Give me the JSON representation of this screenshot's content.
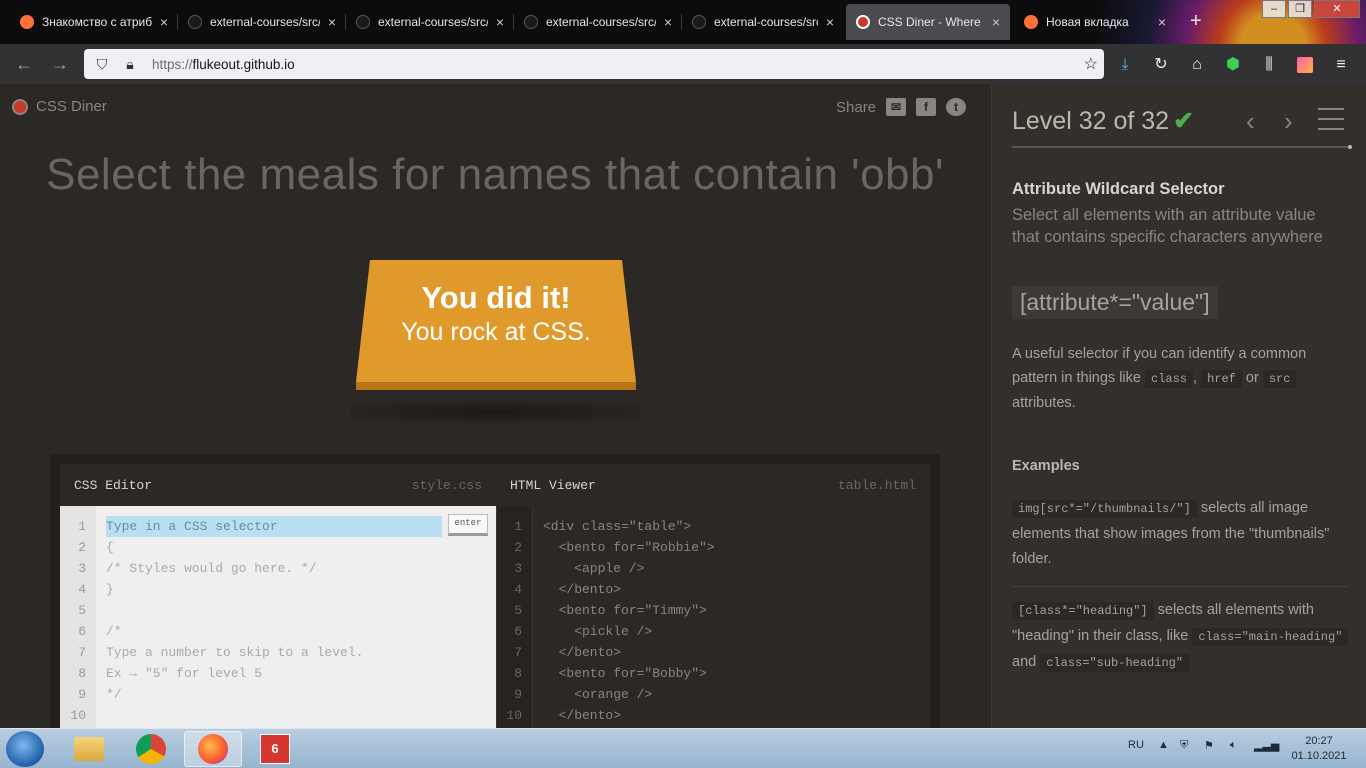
{
  "browser": {
    "tabs": [
      {
        "title": "Знакомство с атрибу",
        "favicon_color": "#ff7139"
      },
      {
        "title": "external-courses/src/",
        "favicon_color": "#1b1b1f"
      },
      {
        "title": "external-courses/src/",
        "favicon_color": "#1b1b1f"
      },
      {
        "title": "external-courses/src/",
        "favicon_color": "#1b1b1f"
      },
      {
        "title": "external-courses/src/",
        "favicon_color": "#1b1b1f"
      },
      {
        "title": "CSS Diner - Where we",
        "favicon_color": "#c8392b"
      },
      {
        "title": "Новая вкладка",
        "favicon_color": "#ff7139"
      }
    ],
    "tab_close": "×",
    "new_tab": "+",
    "window_controls": {
      "minimize": "–",
      "restore": "❐",
      "close": "✕"
    },
    "url": {
      "prefix": "https://",
      "host": "flukeout.github.io"
    },
    "icons": [
      "back-icon",
      "forward-icon",
      "shield-icon",
      "lock-icon",
      "star-icon",
      "download-icon",
      "reload-icon",
      "home-icon",
      "extension-icon",
      "library-icon",
      "profile-icon",
      "menu-icon"
    ]
  },
  "site": {
    "logo": "CSS Diner",
    "share_label": "Share",
    "headline": "Select the meals for names that contain 'obb'",
    "success": {
      "line1": "You did it!",
      "line2": "You rock at CSS."
    },
    "table_color": "#e09a2b"
  },
  "editor": {
    "css_title": "CSS Editor",
    "css_file": "style.css",
    "enter_label": "enter",
    "css_placeholder": "Type in a CSS selector",
    "css_lines": [
      "{",
      "/* Styles would go here. */",
      "}",
      "",
      "/*",
      "Type a number to skip to a level.",
      "Ex → \"5\" for level 5",
      "*/",
      ""
    ],
    "line_numbers": [
      "1",
      "2",
      "3",
      "4",
      "5",
      "6",
      "7",
      "8",
      "9",
      "10"
    ],
    "html_title": "HTML Viewer",
    "html_file": "table.html",
    "html_lines": [
      "<div class=\"table\">",
      "  <bento for=\"Robbie\">",
      "    <apple />",
      "  </bento>",
      "  <bento for=\"Timmy\">",
      "    <pickle />",
      "  </bento>",
      "  <bento for=\"Bobby\">",
      "    <orange />",
      "  </bento>"
    ]
  },
  "sidebar": {
    "level_text": "Level 32 of 32",
    "check": "✔",
    "prev": "‹",
    "next": "›",
    "title": "Attribute Wildcard Selector",
    "description": "Select all elements with an attribute value that contains specific characters anywhere",
    "syntax": "[attribute*=\"value\"]",
    "help_pre": "A useful selector if you can identify a common pattern in things like",
    "help_chip1": "class",
    "help_comma": ",",
    "help_chip2": "href",
    "help_or": "or",
    "help_chip3": "src",
    "help_post": "attributes.",
    "examples_title": "Examples",
    "ex1_code": "img[src*=\"/thumbnails/\"]",
    "ex1_text": "selects all image elements that show images from the \"thumbnails\" folder.",
    "ex2_code": "[class*=\"heading\"]",
    "ex2_text": "selects all elements with \"heading\" in their class, like",
    "ex2_chip1": "class=\"main-heading\"",
    "ex2_and": "and",
    "ex2_chip2": "class=\"sub-heading\""
  },
  "taskbar": {
    "apps": [
      "explorer",
      "chrome",
      "firefox",
      "6 demo"
    ],
    "lang": "RU",
    "time": "20:27",
    "date": "01.10.2021"
  }
}
